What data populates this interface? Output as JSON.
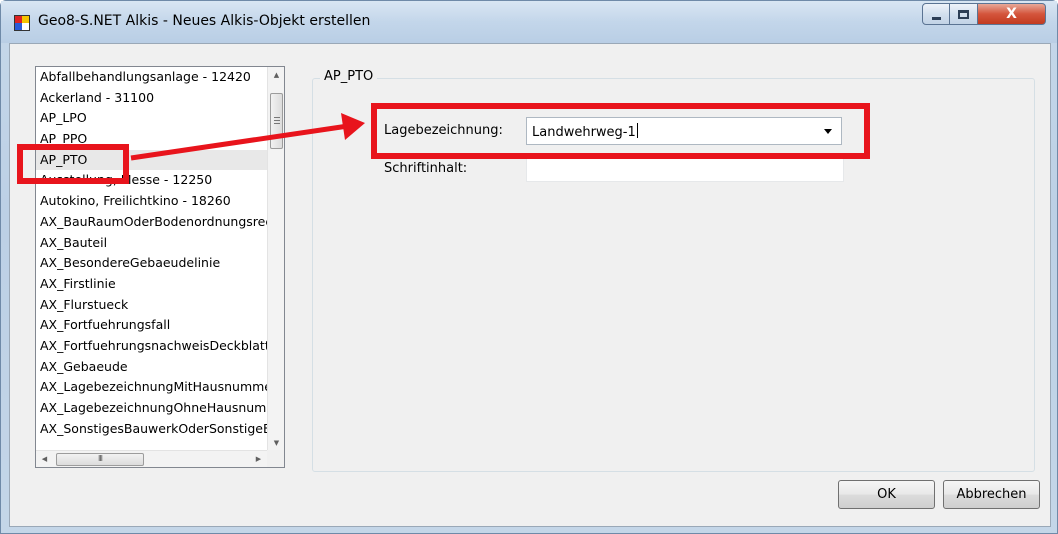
{
  "window": {
    "title": "Geo8-S.NET Alkis - Neues Alkis-Objekt erstellen",
    "caption_buttons": {
      "minimize_icon": "minimize-icon",
      "maximize_icon": "maximize-icon",
      "close_label": "X"
    }
  },
  "object_list": {
    "items": [
      "Abfallbehandlungsanlage - 12420",
      "Ackerland - 31100",
      "AP_LPO",
      "AP_PPO",
      "AP_PTO",
      "Ausstellung, Messe - 12250",
      "Autokino, Freilichtkino - 18260",
      "AX_BauRaumOderBodenordnungsrecht",
      "AX_Bauteil",
      "AX_BesondereGebaeudelinie",
      "AX_Firstlinie",
      "AX_Flurstueck",
      "AX_Fortfuehrungsfall",
      "AX_FortfuehrungsnachweisDeckblatt",
      "AX_Gebaeude",
      "AX_LagebezeichnungMitHausnummer",
      "AX_LagebezeichnungOhneHausnummer",
      "AX_SonstigesBauwerkOderSonstigeEinrichtung"
    ],
    "selected": "AP_PTO",
    "hscroll_thumb_glyph": "III"
  },
  "properties": {
    "group_title": "AP_PTO",
    "lagebezeichnung": {
      "label": "Lagebezeichnung:",
      "value": "Landwehrweg-1"
    },
    "schriftinhalt": {
      "label": "Schriftinhalt:",
      "value": ""
    }
  },
  "buttons": {
    "ok": "OK",
    "cancel": "Abbrechen"
  },
  "annotation": {
    "color": "#e8141c"
  }
}
